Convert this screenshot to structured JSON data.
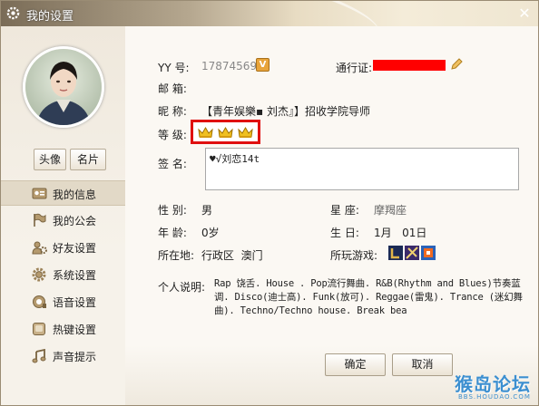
{
  "window": {
    "title": "我的设置",
    "close_glyph": "✕"
  },
  "sidebar": {
    "avatar_buttons": {
      "photo": "头像",
      "card": "名片"
    },
    "items": [
      {
        "label": "我的信息",
        "icon": "profile-card-icon",
        "active": true
      },
      {
        "label": "我的公会",
        "icon": "flag-icon",
        "active": false
      },
      {
        "label": "好友设置",
        "icon": "friends-gear-icon",
        "active": false
      },
      {
        "label": "系统设置",
        "icon": "gear-icon",
        "active": false
      },
      {
        "label": "语音设置",
        "icon": "voice-icon",
        "active": false
      },
      {
        "label": "热键设置",
        "icon": "hotkey-icon",
        "active": false
      },
      {
        "label": "声音提示",
        "icon": "music-note-icon",
        "active": false
      }
    ]
  },
  "profile": {
    "yy_label": "YY 号:",
    "yy_number": "178745692",
    "yy_badge": "V",
    "pass_label": "通行证:",
    "email_label": "邮  箱:",
    "email_value": "",
    "nickname_label": "昵  称:",
    "nickname_value": "【青年娱樂▪ 刘杰』】招收学院导师",
    "level_label": "等  级:",
    "level_crowns": 3,
    "signature_label": "签  名:",
    "signature_value": "♥√刘恋14t",
    "gender_label": "性  别:",
    "gender_value": "男",
    "zodiac_label": "星  座:",
    "zodiac_value": "摩羯座",
    "age_label": "年  龄:",
    "age_value": "0岁",
    "birthday_label": "生  日:",
    "birthday_value": "1月   01日",
    "location_label": "所在地:",
    "location_value": "行政区  澳门",
    "games_label": "所玩游戏:",
    "about_label": "个人说明:",
    "about_value": "Rap 饶舌.  House . Pop流行舞曲. R&B(Rhythm and Blues)节奏蓝调. Disco(迪士高). Funk(放可). Reggae(雷鬼). Trance (迷幻舞曲). Techno/Techno house. Break bea"
  },
  "footer": {
    "ok": "确定",
    "cancel": "取消"
  },
  "watermark": {
    "main": "猴岛论坛",
    "sub": "BBS.HOUDAO.COM"
  },
  "colors": {
    "highlight_red": "#e01010",
    "redact_red": "#ff0000",
    "crown_gold": "#f0c020"
  }
}
